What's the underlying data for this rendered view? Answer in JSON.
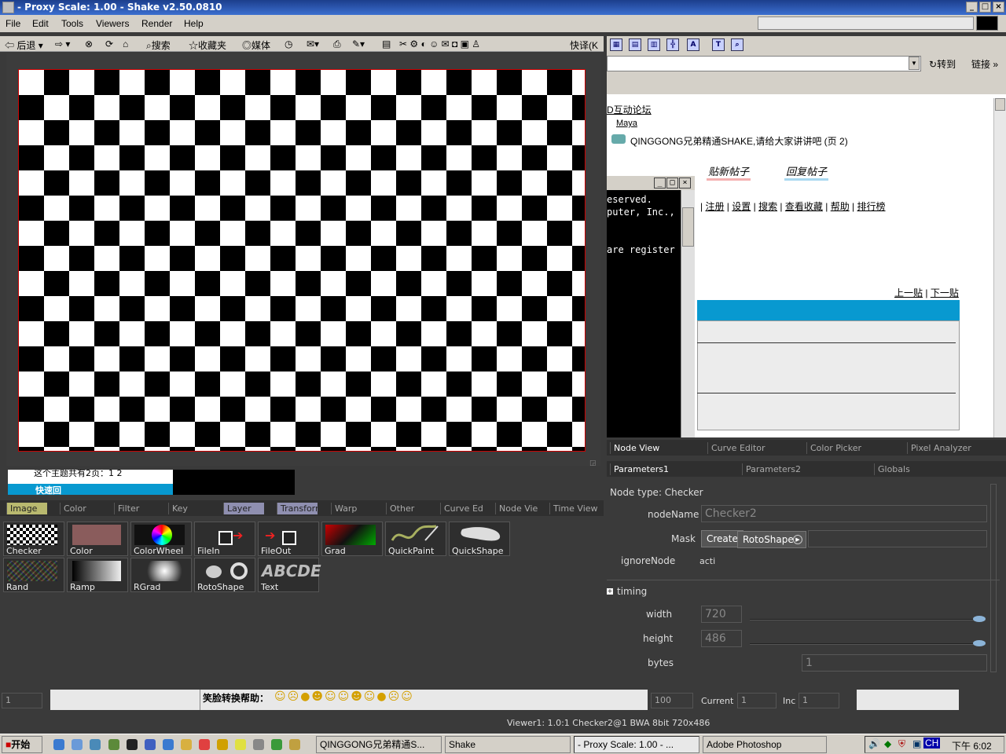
{
  "window": {
    "title": "- Proxy Scale: 1.00 - Shake v2.50.0810",
    "buttons": [
      "_",
      "□",
      "×"
    ]
  },
  "menu": [
    "File",
    "Edit",
    "Tools",
    "Viewers",
    "Render",
    "Help"
  ],
  "ie_toolbar": {
    "back": "后退",
    "search": "搜索",
    "favorites": "收藏夹",
    "media": "媒体",
    "translate": "快译(K"
  },
  "address": {
    "go": "转到",
    "links": "链接"
  },
  "webpage": {
    "forum": "D互动论坛",
    "maya": "Maya",
    "thread": "QINGGONG兄弟精通SHAKE,请给大家讲讲吧 (页 2)",
    "new_post": "贴新帖子",
    "reply": "回复帖子",
    "nav": [
      "注册",
      "设置",
      "搜索",
      "查看收藏",
      "帮助",
      "排行榜"
    ],
    "prev": "上一贴",
    "next": "下一贴"
  },
  "terminal": {
    "lines": [
      "eserved.",
      "puter, Inc.,",
      "",
      "are register"
    ]
  },
  "ghost": {
    "text": "这个主题共有2页：1 2",
    "tab": "快速回"
  },
  "viewer": {
    "corner": "◲"
  },
  "node_tabs": [
    "Image",
    "Color",
    "Filter",
    "Key",
    "Layer",
    "Transform",
    "Warp",
    "Other",
    "Curve Ed",
    "Node Vie",
    "Time View"
  ],
  "nodes": [
    {
      "name": "Checker",
      "icon": "checker-icon"
    },
    {
      "name": "Color",
      "icon": "color-swatch-icon"
    },
    {
      "name": "ColorWheel",
      "icon": "color-wheel-icon"
    },
    {
      "name": "FileIn",
      "icon": "file-in-icon"
    },
    {
      "name": "FileOut",
      "icon": "file-out-icon"
    },
    {
      "name": "Grad",
      "icon": "gradient-icon"
    },
    {
      "name": "QuickPaint",
      "icon": "paint-brush-icon"
    },
    {
      "name": "QuickShape",
      "icon": "shape-icon"
    },
    {
      "name": "Rand",
      "icon": "noise-icon"
    },
    {
      "name": "Ramp",
      "icon": "ramp-icon"
    },
    {
      "name": "RGrad",
      "icon": "radial-gradient-icon"
    },
    {
      "name": "RotoShape",
      "icon": "roto-shape-icon"
    },
    {
      "name": "Text",
      "icon": "text-icon",
      "glyph": "ABCDE"
    }
  ],
  "view_tabs": [
    "Node View",
    "Curve Editor",
    "Color Picker",
    "Pixel Analyzer"
  ],
  "param_tabs": [
    "Parameters1",
    "Parameters2",
    "Globals"
  ],
  "params": {
    "node_type": "Node type: Checker",
    "nodeName_label": "nodeName",
    "nodeName": "Checker2",
    "mask_label": "Mask",
    "create": "Create",
    "rotoshape": "RotoShape",
    "ignoreNode_label": "ignoreNode",
    "ignoreNode": "acti",
    "timing": "timing",
    "width_label": "width",
    "width": "720",
    "height_label": "height",
    "height": "486",
    "bytes_label": "bytes",
    "bytes": "1"
  },
  "time": {
    "frame": "1",
    "end": "100",
    "current_label": "Current",
    "current": "1",
    "inc_label": "Inc",
    "inc": "1"
  },
  "smiley": {
    "label": "笑脸转换帮助："
  },
  "status": "Viewer1: 1.0:1 Checker2@1 BWA 8bit 720x486",
  "taskbar": {
    "start": "开始",
    "items": [
      "QINGGONG兄弟精通S...",
      "Shake",
      "- Proxy Scale: 1.00 - ...",
      "Adobe Photoshop"
    ],
    "lang": "CH",
    "clock": "下午 6:02"
  },
  "colors": {
    "title": "#1c3e8c",
    "accent": "#0899d0",
    "panel": "#3a3a3a"
  }
}
